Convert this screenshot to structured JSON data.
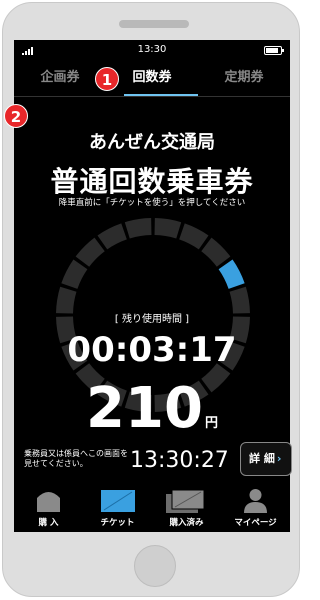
{
  "status_bar": {
    "time": "13:30"
  },
  "tabs": [
    {
      "label": "企画券",
      "active": false
    },
    {
      "label": "回数券",
      "active": true
    },
    {
      "label": "定期券",
      "active": false
    }
  ],
  "badges": {
    "first": "1",
    "second": "2"
  },
  "ticket": {
    "operator": "あんぜん交通局",
    "title": "普通回数乗車券",
    "notice": "降車直前に「チケットを使う」を押してください",
    "remaining_label": "[ 残り使用時間 ]",
    "remaining_time": "00:03:17",
    "fare_value": "210",
    "fare_unit": "円",
    "ring_segments_total": 20,
    "ring_segments_highlighted": 1
  },
  "footer": {
    "staff_note": "乗務員又は係員へこの画面を見せてください。",
    "clock": "13:30:27",
    "detail_label": "詳 細",
    "detail_chevron": "›"
  },
  "nav": [
    {
      "label": "購 入",
      "icon": "home-icon"
    },
    {
      "label": "チケット",
      "icon": "ticket-icon"
    },
    {
      "label": "購入済み",
      "icon": "purchased-tickets-icon"
    },
    {
      "label": "マイページ",
      "icon": "user-icon"
    }
  ],
  "colors": {
    "accent": "#3aa0e0",
    "badge": "#e8272a",
    "background": "#000000",
    "device": "#dedede"
  }
}
